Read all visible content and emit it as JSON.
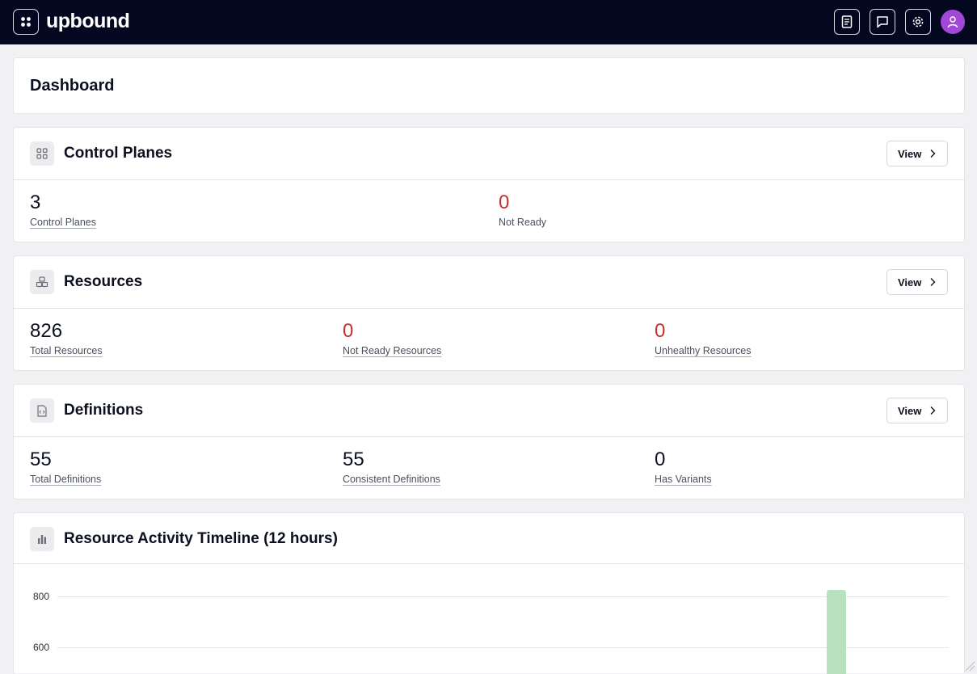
{
  "header": {
    "logo": "upbound",
    "icons": [
      "apps-icon",
      "docs-icon",
      "chat-icon",
      "settings-icon",
      "user-icon"
    ]
  },
  "page": {
    "title": "Dashboard"
  },
  "control_planes": {
    "title": "Control Planes",
    "view_label": "View",
    "metrics": [
      {
        "value": "3",
        "label": "Control Planes"
      },
      {
        "value": "0",
        "label": "Not Ready"
      }
    ]
  },
  "resources": {
    "title": "Resources",
    "view_label": "View",
    "metrics": [
      {
        "value": "826",
        "label": "Total Resources"
      },
      {
        "value": "0",
        "label": "Not Ready Resources"
      },
      {
        "value": "0",
        "label": "Unhealthy Resources"
      }
    ]
  },
  "definitions": {
    "title": "Definitions",
    "view_label": "View",
    "metrics": [
      {
        "value": "55",
        "label": "Total Definitions"
      },
      {
        "value": "55",
        "label": "Consistent Definitions"
      },
      {
        "value": "0",
        "label": "Has Variants"
      }
    ]
  },
  "timeline": {
    "title": "Resource Activity Timeline (12 hours)"
  },
  "chart_data": {
    "type": "bar",
    "title": "Resource Activity Timeline (12 hours)",
    "y_ticks": [
      "800",
      "600"
    ],
    "visible_y_range": [
      550,
      800
    ],
    "values": [
      826
    ],
    "bar_color": "#b8e2bd"
  },
  "colors": {
    "topbar": "#040720",
    "error": "#c4302b",
    "avatar": "#a248d6"
  }
}
